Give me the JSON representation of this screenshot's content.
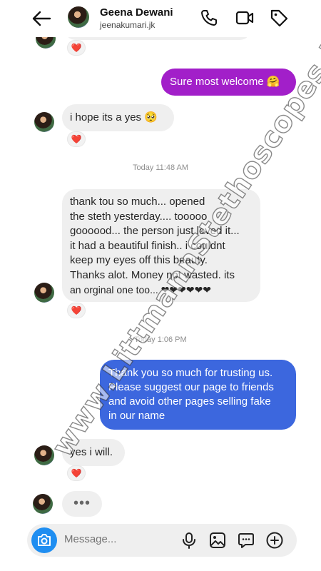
{
  "header": {
    "name": "Geena Dewani",
    "username": "jeenakumari.jk"
  },
  "messages": {
    "m1": {
      "text": "Sure most welcome 🤗"
    },
    "m2": {
      "text": "i hope its a yes 🥺"
    },
    "stamp1": "Today 11:48 AM",
    "m3": {
      "lines": [
        "thank tou so much... opened",
        "the steth yesterday.... tooooo",
        "goooood... the person just loved it...",
        "it had a beautiful finish.. i couldnt",
        "keep my eyes off this beauty.",
        "Thanks alot. Money not wasted. its",
        "an orginal one too... ❤❤❤❤❤❤"
      ]
    },
    "stamp2": "Today 1:06 PM",
    "m4": {
      "lines": [
        "Thank you so much for trusting us.",
        "Please suggest our page to friends",
        "and avoid other pages selling fake",
        "in our name"
      ]
    },
    "m5": {
      "text": "yes i will."
    },
    "typing": "•••",
    "reaction": "❤️"
  },
  "watermark": "www.LittmannStethoscopes.PK",
  "composer": {
    "placeholder": "Message..."
  },
  "icons": [
    "back-arrow-icon",
    "phone-icon",
    "video-icon",
    "tag-icon",
    "camera-icon",
    "microphone-icon",
    "gallery-icon",
    "sticker-icon",
    "plus-icon"
  ]
}
